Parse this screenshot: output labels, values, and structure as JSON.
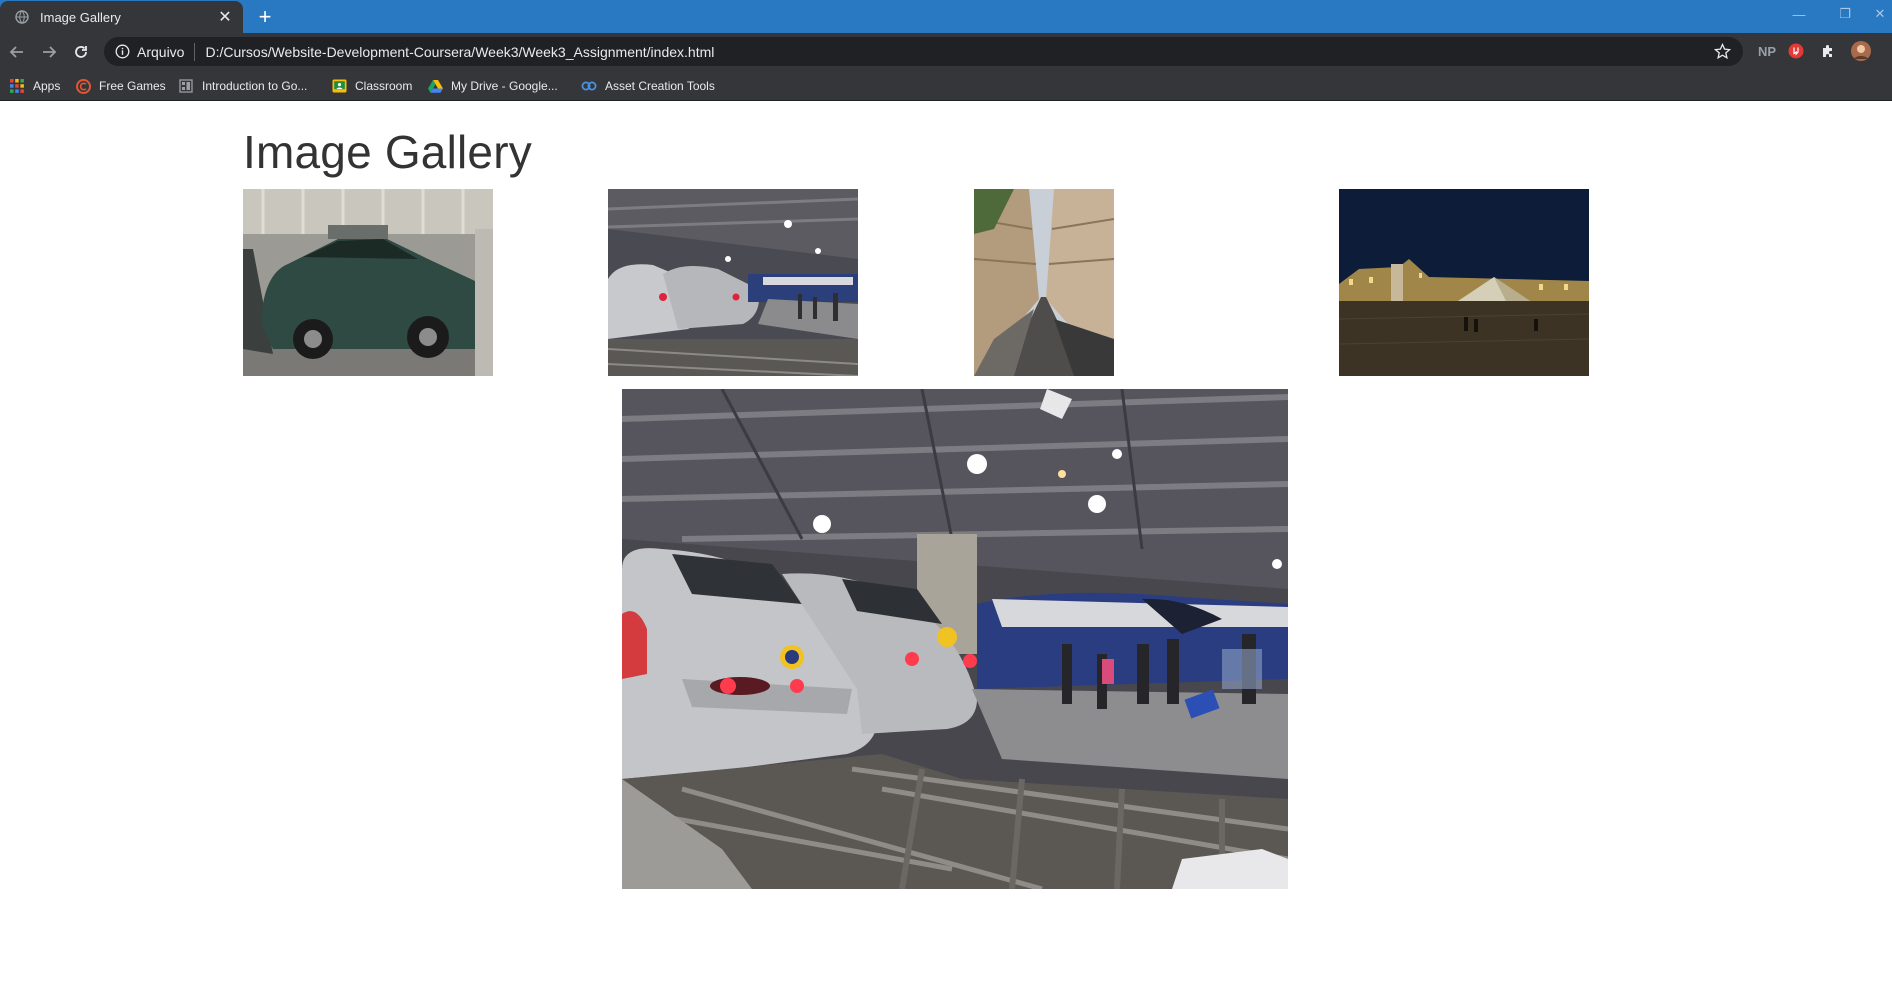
{
  "browser": {
    "tab_title": "Image Gallery",
    "omnibox_scheme": "Arquivo",
    "url": "D:/Cursos/Website-Development-Coursera/Week3/Week3_Assignment/index.html",
    "extension_np": "NP",
    "icons": {
      "back": "arrow-left-icon",
      "forward": "arrow-right-icon",
      "reload": "reload-icon",
      "info": "info-icon",
      "star": "star-icon",
      "extensions": "puzzle-icon"
    },
    "accent_color": "#2978c2"
  },
  "bookmarks": [
    {
      "label": "Apps",
      "icon": "apps-grid-icon"
    },
    {
      "label": "Free Games",
      "icon": "free-games-icon"
    },
    {
      "label": "Introduction to Go...",
      "icon": "bookmark-page-icon"
    },
    {
      "label": "Classroom",
      "icon": "classroom-icon"
    },
    {
      "label": "My Drive - Google...",
      "icon": "google-drive-icon"
    },
    {
      "label": "Asset Creation Tools",
      "icon": "asset-tools-icon"
    }
  ],
  "gallery": {
    "title": "Image Gallery",
    "thumbnails": [
      {
        "subject": "mini-car"
      },
      {
        "subject": "trains"
      },
      {
        "subject": "paris-street"
      },
      {
        "subject": "louvre-pyramid"
      }
    ],
    "selected": {
      "subject": "trains"
    }
  }
}
